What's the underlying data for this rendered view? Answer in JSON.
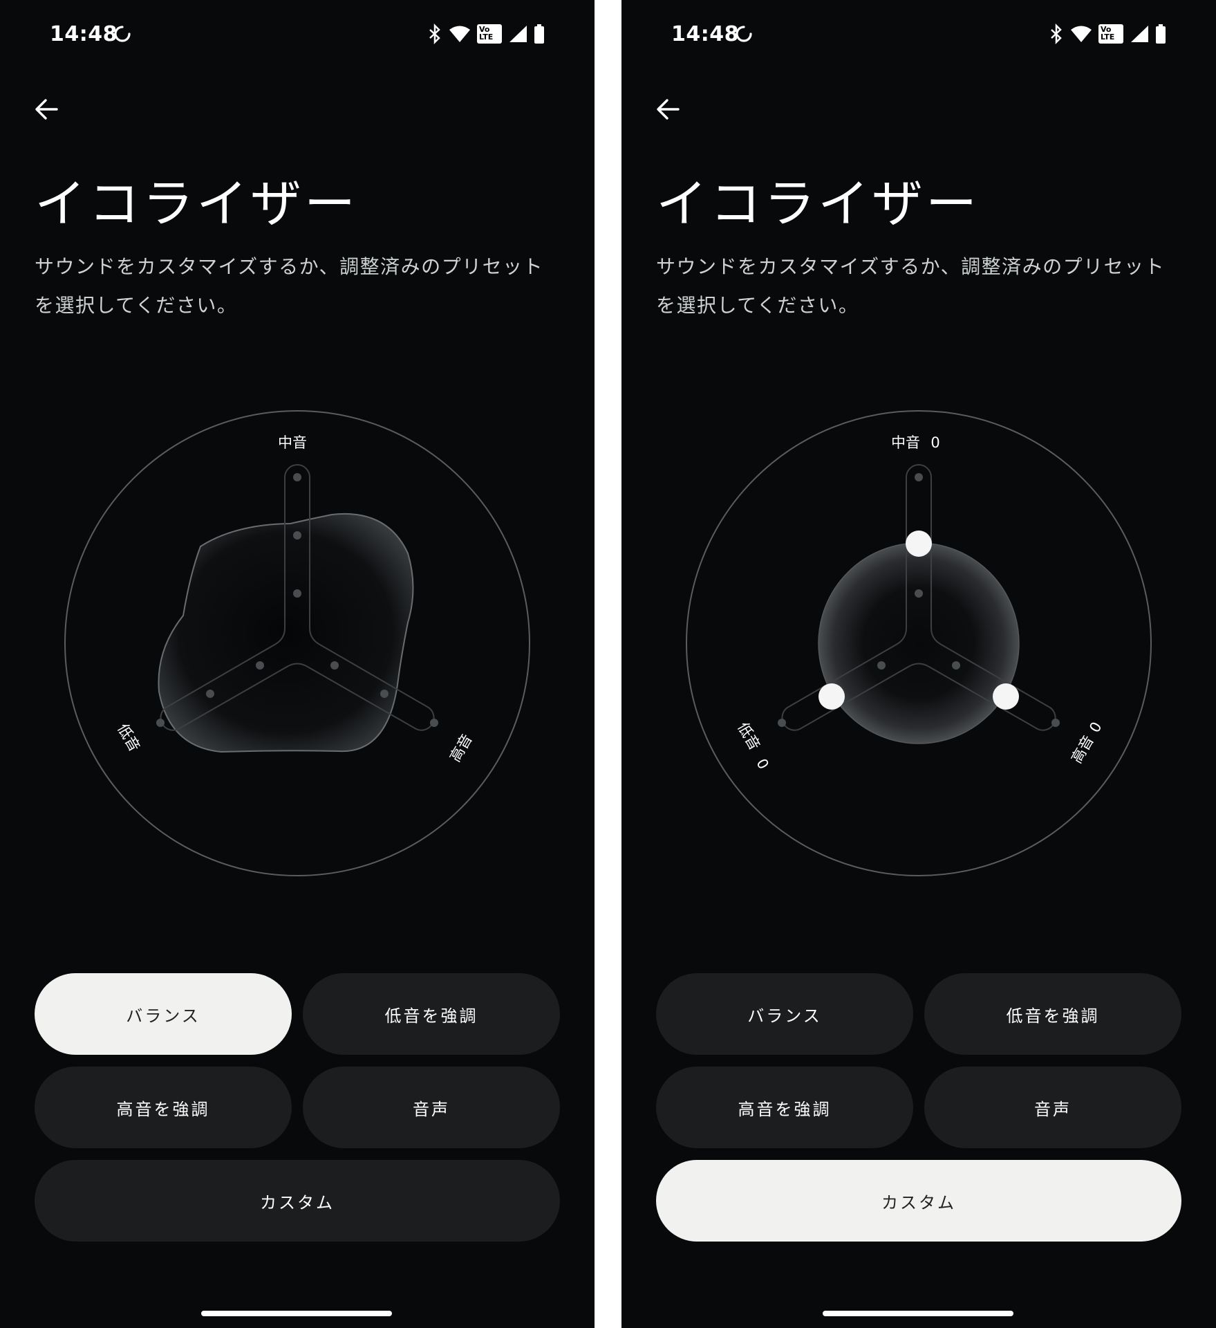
{
  "status_bar": {
    "time": "14:48",
    "volte": [
      "Vo",
      "LTE"
    ]
  },
  "page": {
    "title": "イコライザー",
    "description": "サウンドをカスタマイズするか、調整済みのプリセットを選択してください。"
  },
  "axes": {
    "mid": "中音",
    "bass": "低音",
    "treble": "高音"
  },
  "presets": {
    "balance": "バランス",
    "bass_boost": "低音を強調",
    "treble_boost": "高音を強調",
    "voice": "音声",
    "custom": "カスタム"
  },
  "screens": [
    {
      "id": "left",
      "selected_preset": "balance",
      "show_values": false
    },
    {
      "id": "right",
      "selected_preset": "custom",
      "show_values": true,
      "values": {
        "mid": "0",
        "bass": "0",
        "treble": "0"
      }
    }
  ],
  "colors": {
    "background": "#07090b",
    "button": "#1b1d1f",
    "button_selected": "#f1f2f0"
  }
}
